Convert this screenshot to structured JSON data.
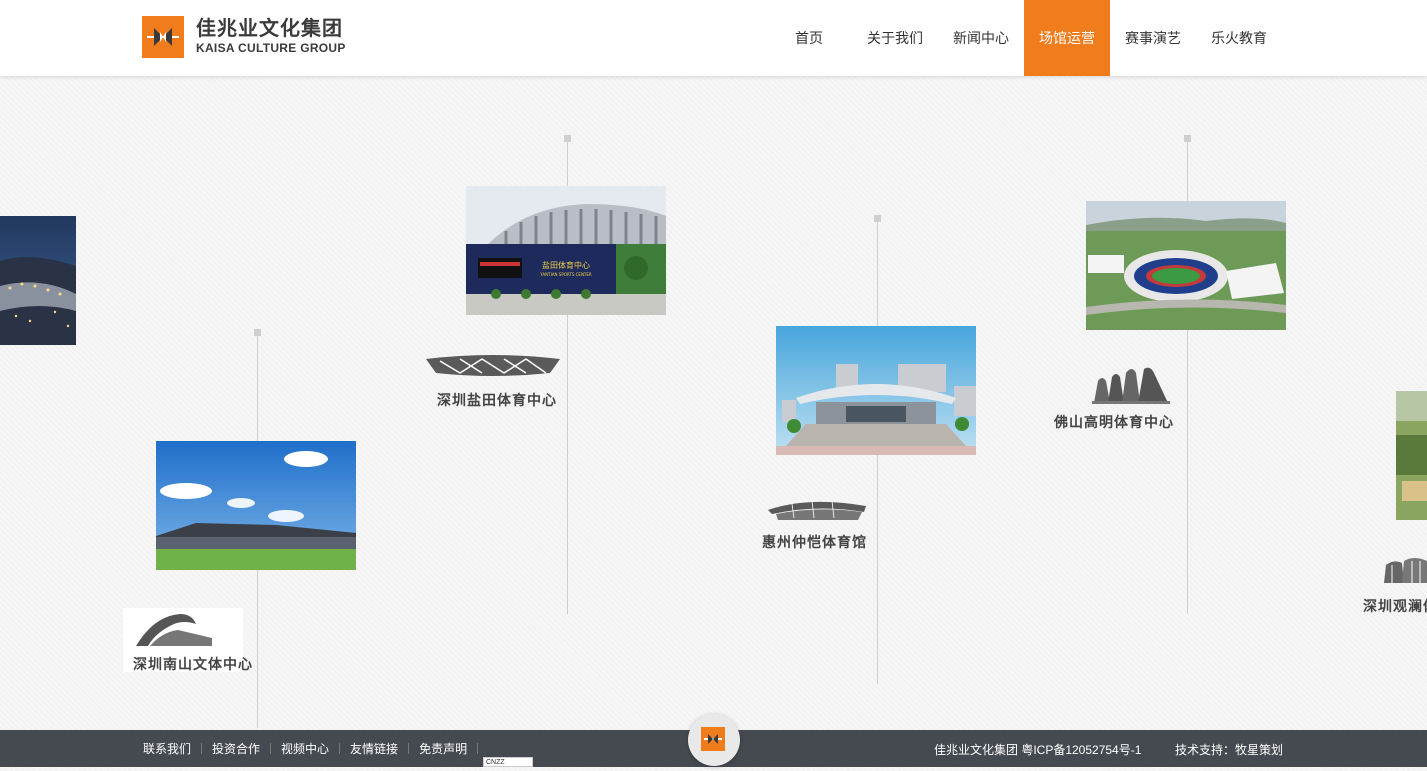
{
  "brand": {
    "name_cn": "佳兆业文化集团",
    "name_en": "KAISA CULTURE GROUP",
    "color": "#f07c1b"
  },
  "nav": {
    "items": [
      {
        "label": "首页"
      },
      {
        "label": "关于我们"
      },
      {
        "label": "新闻中心"
      },
      {
        "label": "场馆运营",
        "active": true
      },
      {
        "label": "赛事演艺"
      },
      {
        "label": "乐火教育"
      }
    ]
  },
  "venues": [
    {
      "name": "深圳南山文体中心"
    },
    {
      "name": "深圳盐田体育中心",
      "photo_sign": "盐田体育中心",
      "photo_sign_en": "YANTIAN SPORTS CENTER"
    },
    {
      "name": "惠州仲恺体育馆"
    },
    {
      "name": "佛山高明体育中心"
    },
    {
      "name": "深圳观澜体"
    }
  ],
  "footer": {
    "links": [
      "联系我们",
      "投资合作",
      "视频中心",
      "友情链接",
      "免责声明"
    ],
    "icp": "佳兆业文化集团 粤ICP备12052754号-1",
    "tech": "技术支持：牧星策划",
    "badge": "CNZZ"
  }
}
